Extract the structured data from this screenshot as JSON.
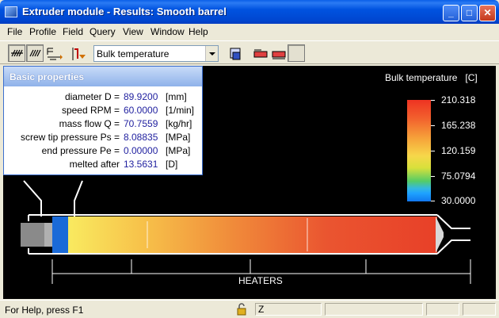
{
  "window": {
    "title": "Extruder module - Results: Smooth barrel",
    "controls": {
      "minimize": "_",
      "maximize": "□",
      "close": "✕"
    }
  },
  "menu": [
    "File",
    "Profile",
    "Field",
    "Query",
    "View",
    "Window",
    "Help"
  ],
  "toolbar": {
    "field_select": "Bulk temperature"
  },
  "properties": {
    "title": "Basic properties",
    "rows": [
      {
        "label": "diameter  D =",
        "value": "89.9200",
        "unit": "[mm]"
      },
      {
        "label": "speed  RPM =",
        "value": "60.0000",
        "unit": "[1/min]"
      },
      {
        "label": "mass flow  Q =",
        "value": "70.7559",
        "unit": "[kg/hr]"
      },
      {
        "label": "screw tip pressure Ps =",
        "value": "8.08835",
        "unit": "[MPa]"
      },
      {
        "label": "end pressure Pe =",
        "value": "0.00000",
        "unit": "[MPa]"
      },
      {
        "label": "melted after",
        "value": "13.5631",
        "unit": "[D]"
      }
    ]
  },
  "legend": {
    "title": "Bulk temperature",
    "unit": "[C]",
    "labels": [
      "210.318",
      "165.238",
      "120.159",
      "75.0794",
      "30.0000"
    ]
  },
  "diagram": {
    "heaters_label": "HEATERS"
  },
  "status": {
    "help": "For Help, press F1",
    "pane_z": "Z"
  }
}
